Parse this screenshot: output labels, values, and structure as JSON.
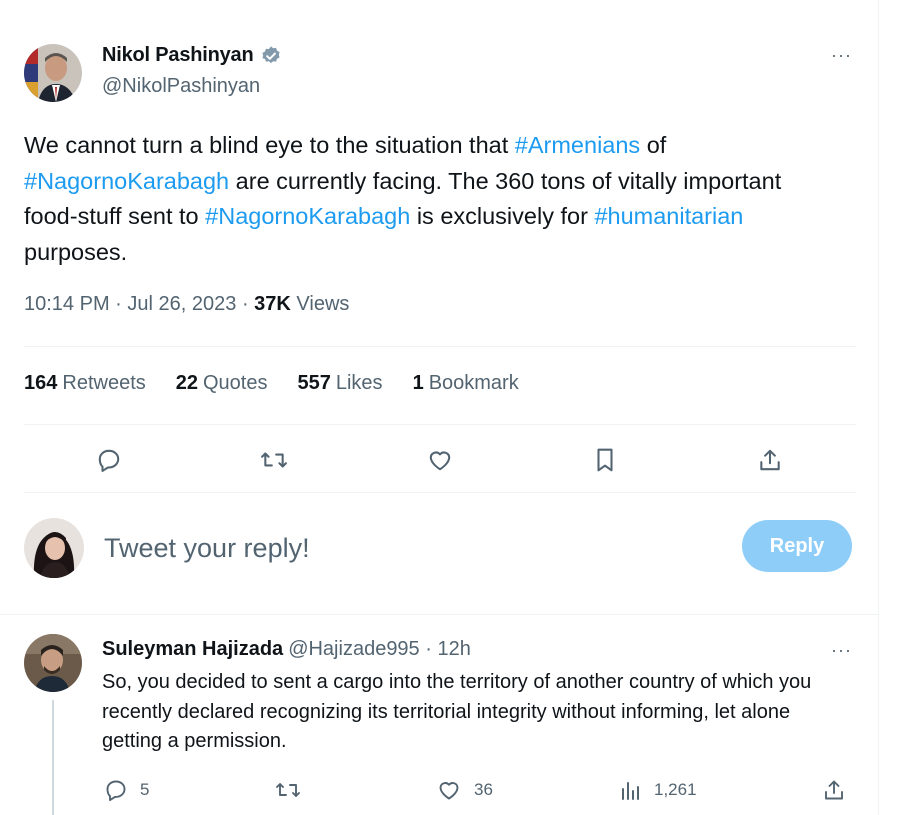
{
  "tweet": {
    "author": {
      "display_name": "Nikol Pashinyan",
      "handle": "@NikolPashinyan",
      "verified_icon": "verified-badge-icon"
    },
    "text_parts": [
      {
        "t": "We cannot turn a blind eye to the situation that ",
        "tag": false
      },
      {
        "t": "#Armenians",
        "tag": true
      },
      {
        "t": " of ",
        "tag": false
      },
      {
        "t": "#NagornoKarabagh",
        "tag": true
      },
      {
        "t": " are currently facing. The 360 tons of vitally important food-stuff sent to ",
        "tag": false
      },
      {
        "t": "#NagornoKarabagh",
        "tag": true
      },
      {
        "t": " is exclusively for ",
        "tag": false
      },
      {
        "t": "#humanitarian",
        "tag": true
      },
      {
        "t": " purposes.",
        "tag": false
      }
    ],
    "time": "10:14 PM",
    "date": "Jul 26, 2023",
    "views_count": "37K",
    "views_label": "Views",
    "more_label": "···"
  },
  "stats": {
    "retweets_count": "164",
    "retweets_label": "Retweets",
    "quotes_count": "22",
    "quotes_label": "Quotes",
    "likes_count": "557",
    "likes_label": "Likes",
    "bookmarks_count": "1",
    "bookmarks_label": "Bookmark"
  },
  "actions": [
    "reply-icon",
    "retweet-icon",
    "like-icon",
    "bookmark-icon",
    "share-icon"
  ],
  "reply_box": {
    "placeholder": "Tweet your reply!",
    "button_label": "Reply"
  },
  "reply": {
    "display_name": "Suleyman Hajizada",
    "handle": "@Hajizade995",
    "separator": "·",
    "age": "12h",
    "text": "So, you decided to sent a cargo into the territory of another country of which you recently declared recognizing its territorial integrity without informing, let alone getting a permission.",
    "replies_count": "5",
    "retweets_count": "",
    "likes_count": "36",
    "views_count": "1,261",
    "more_label": "···"
  },
  "colors": {
    "accent": "#1d9bf0",
    "accent_disabled": "#8ecdf8",
    "secondary_text": "#536471",
    "primary_text": "#0f1419",
    "divider": "#eff3f4"
  }
}
